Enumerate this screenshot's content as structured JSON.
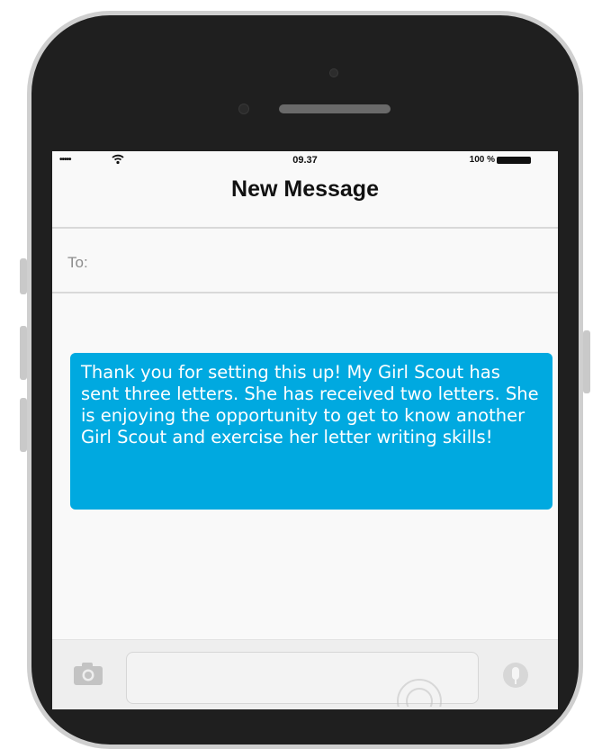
{
  "status_bar": {
    "signal": "•••••",
    "time": "09.37",
    "battery": "100 %"
  },
  "nav": {
    "title": "New Message"
  },
  "recipient": {
    "label": "To:"
  },
  "message": {
    "text": "Thank you for setting this up! My Girl Scout has sent three letters. She has received two letters. She is enjoying the opportunity to get to know another Girl Scout and exercise her letter writing skills!"
  },
  "colors": {
    "bubble": "#00a9e0",
    "phone_body": "#1f1f1f",
    "screen": "#f9f9f9"
  },
  "icons": {
    "camera": "camera-icon",
    "mic": "mic-icon",
    "wifi": "wifi-icon"
  }
}
